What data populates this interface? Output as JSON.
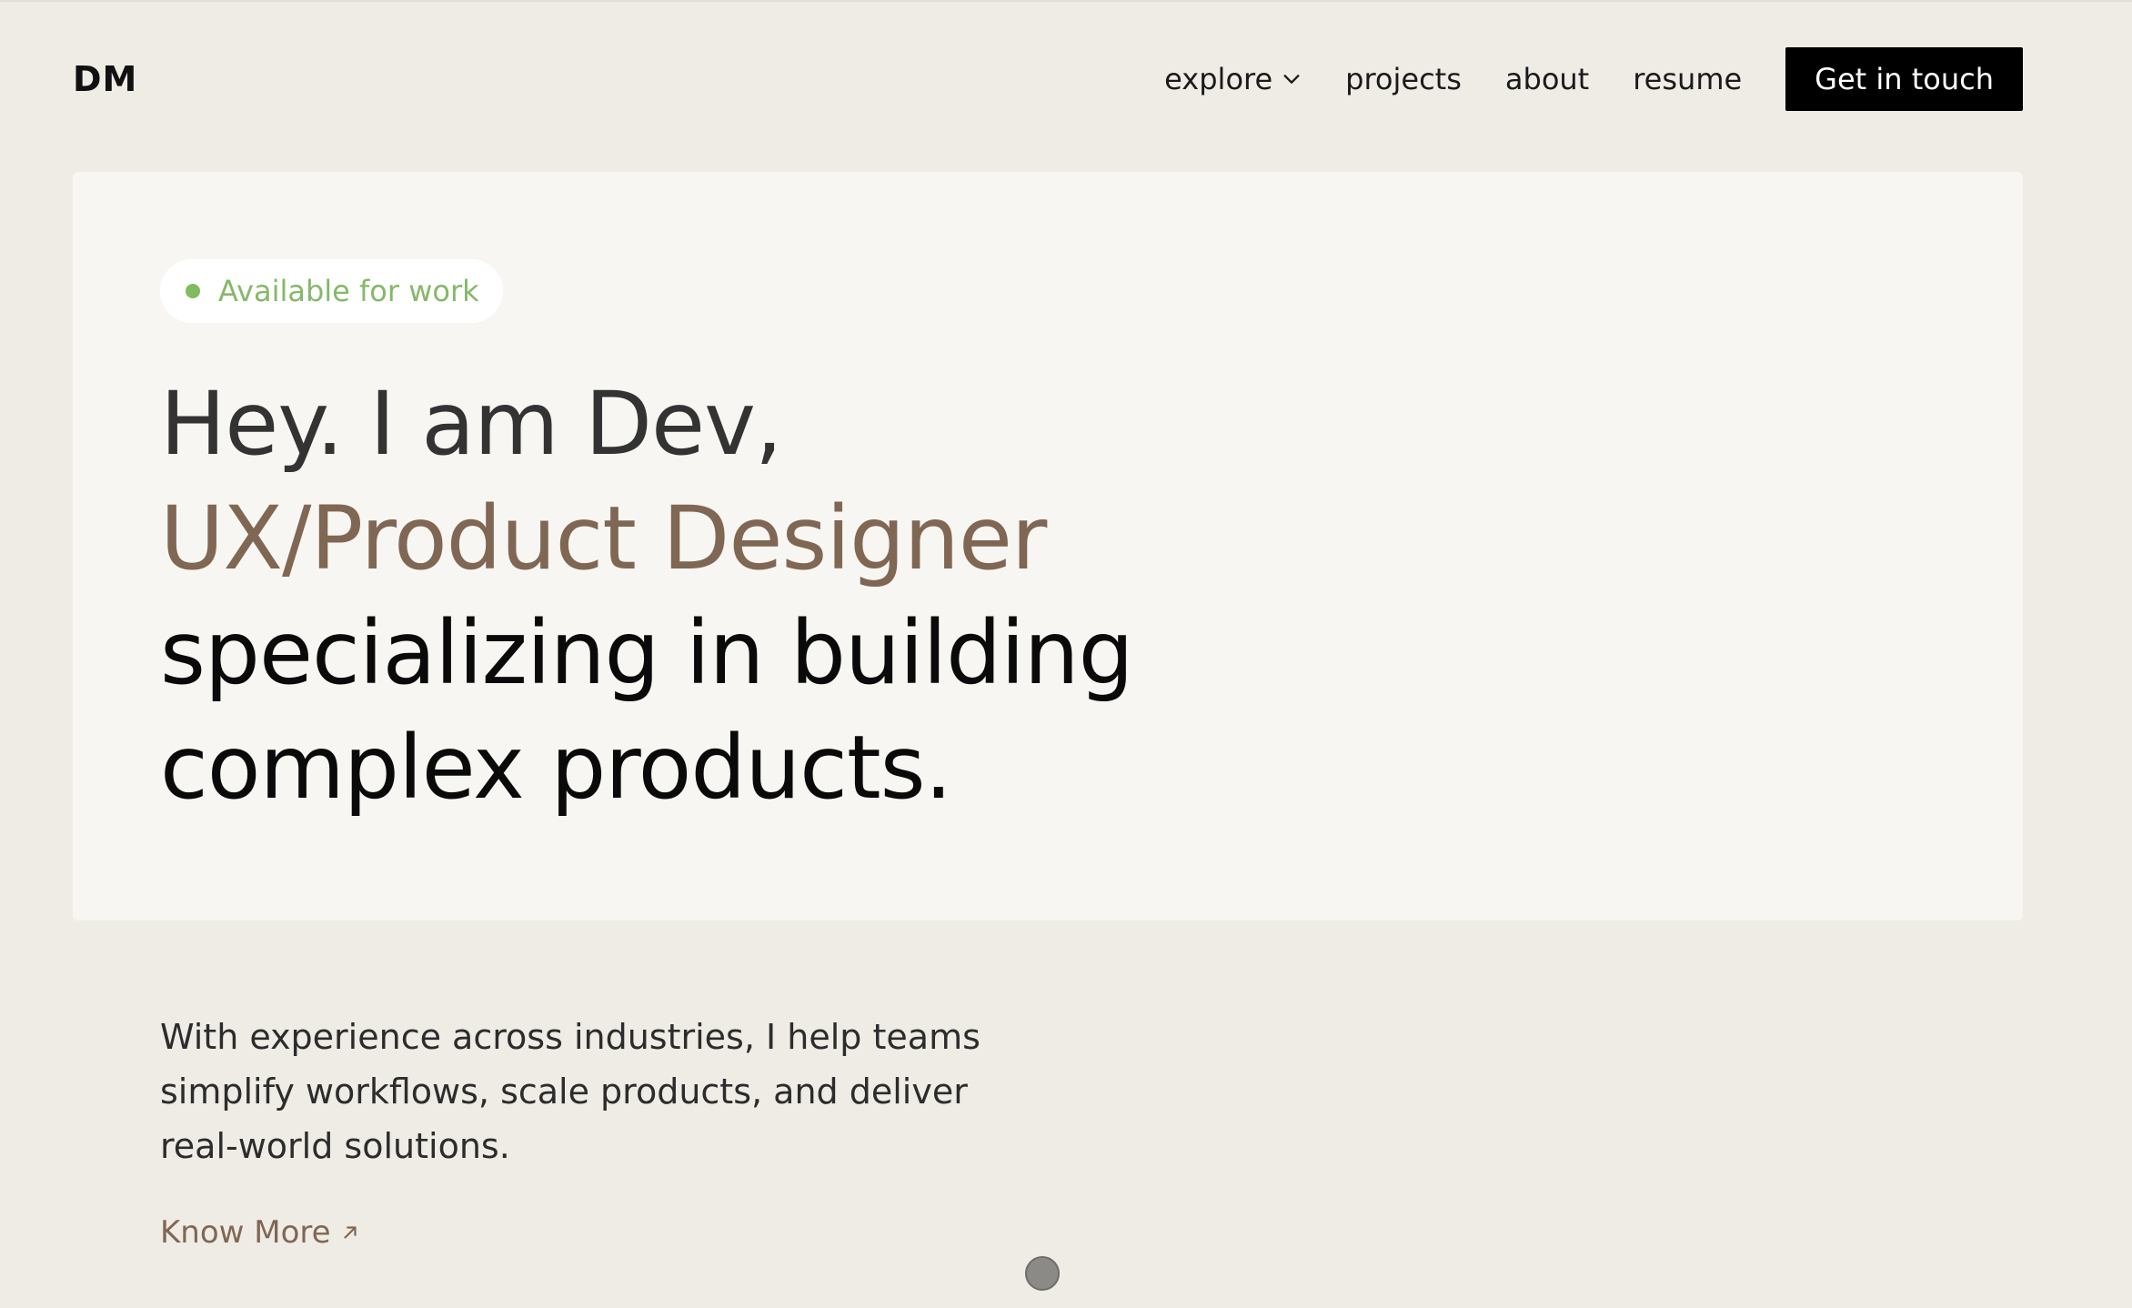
{
  "header": {
    "logo": "DM",
    "nav": {
      "explore": "explore",
      "projects": "projects",
      "about": "about",
      "resume": "resume"
    },
    "cta": "Get in touch"
  },
  "hero": {
    "badge": "Available for work",
    "line1": "Hey. I am Dev,",
    "line2": "UX/Product Designer",
    "line3": "specializing in building",
    "line4": "complex products."
  },
  "intro": {
    "text": "With experience across industries, I help teams simplify workflows, scale products, and deliver real-world solutions.",
    "link": "Know More"
  },
  "colors": {
    "page_bg": "#efece6",
    "card_bg": "#f7f6f3",
    "accent_brown": "#806753",
    "status_green": "#7fbb5f",
    "cta_bg": "#000000"
  },
  "icons": {
    "explore": "chevron-down-icon",
    "know_more": "arrow-up-right-icon",
    "status": "status-dot-icon"
  }
}
